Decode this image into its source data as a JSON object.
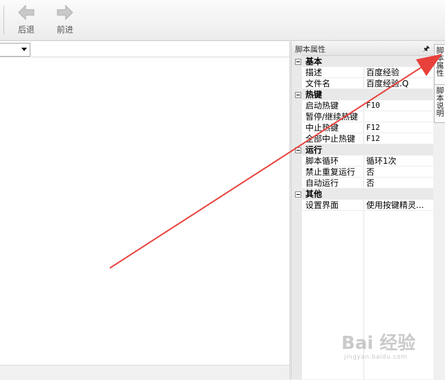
{
  "toolbar": {
    "back_label": "后退",
    "forward_label": "前进"
  },
  "property_panel": {
    "title": "脚本属性",
    "pin_icon": "pin-icon",
    "categories": [
      {
        "name": "基本",
        "props": [
          {
            "name": "描述",
            "value": "百度经验"
          },
          {
            "name": "文件名",
            "value": "百度经验.Q"
          }
        ]
      },
      {
        "name": "热键",
        "props": [
          {
            "name": "启动热键",
            "value": "F10"
          },
          {
            "name": "暂停/继续热键",
            "value": ""
          },
          {
            "name": "中止热键",
            "value": "F12"
          },
          {
            "name": "全部中止热键",
            "value": "F12"
          }
        ]
      },
      {
        "name": "运行",
        "props": [
          {
            "name": "脚本循环",
            "value": "循环1次"
          },
          {
            "name": "禁止重复运行",
            "value": "否"
          },
          {
            "name": "自动运行",
            "value": "否"
          }
        ]
      },
      {
        "name": "其他",
        "props": [
          {
            "name": "设置界面",
            "value": "使用按键精灵..."
          }
        ]
      }
    ]
  },
  "side_tabs": {
    "props_tab": "脚本属性",
    "desc_tab": "脚本说明"
  },
  "watermark": {
    "logo": "Bai 经验",
    "site": "jingyan.baidu.com"
  },
  "colors": {
    "annotation_arrow": "#e8403a"
  }
}
